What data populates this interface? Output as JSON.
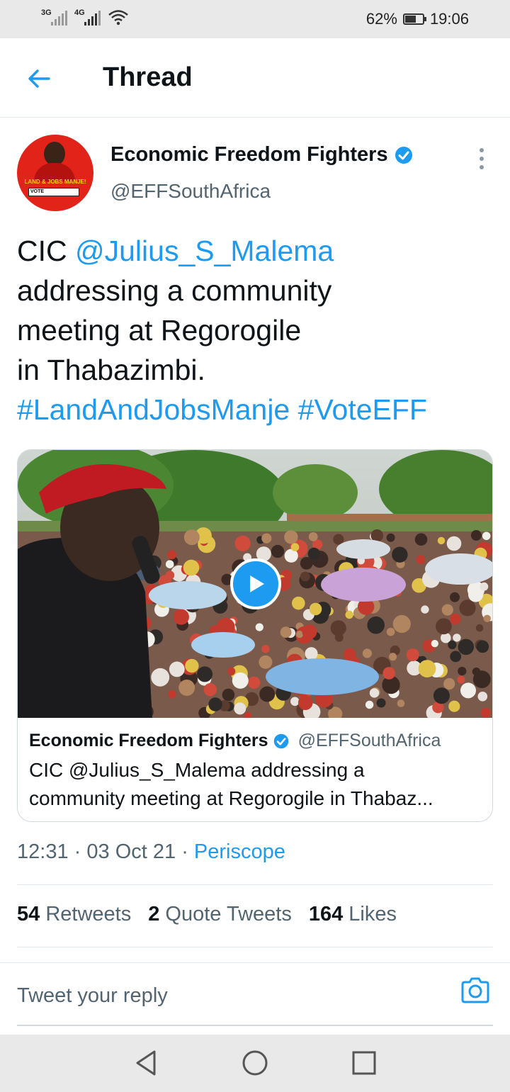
{
  "status_bar": {
    "sim1_tag": "3G",
    "sim2_tag": "4G",
    "battery_percent": "62%",
    "battery_level": 0.62,
    "time": "19:06"
  },
  "header": {
    "title": "Thread",
    "back_icon": "arrow-left-icon"
  },
  "tweet": {
    "author_name": "Economic Freedom Fighters",
    "author_handle": "@EFFSouthAfrica",
    "verified_icon": "verified-badge-icon",
    "avatar_text": {
      "line1": "LAND & JOBS MANJE!",
      "line2": "VOTE"
    },
    "text": {
      "prefix": "CIC ",
      "mention": "@Julius_S_Malema",
      "line2": "addressing a community",
      "line3": "meeting at Regorogile",
      "line4": "in Thabazimbi.",
      "hashtag1": "#LandAndJobsManje",
      "hashtag2": "#VoteEFF"
    },
    "card": {
      "name": "Economic Freedom Fighters",
      "handle": "@EFFSouthAfrica",
      "text_line1": "CIC @Julius_S_Malema addressing a",
      "text_line2": "community meeting at Regorogile in Thabaz..."
    },
    "time": "12:31",
    "date": "03 Oct 21",
    "source": "Periscope",
    "separator": "·",
    "stats": {
      "retweets_count": "54",
      "retweets_label": "Retweets",
      "quotes_count": "2",
      "quotes_label": "Quote Tweets",
      "likes_count": "164",
      "likes_label": "Likes"
    }
  },
  "reply": {
    "placeholder": "Tweet your reply"
  },
  "colors": {
    "accent": "#1d9bf0",
    "text": "#0f1419",
    "secondary": "#536471",
    "eff_red": "#e2231a"
  }
}
